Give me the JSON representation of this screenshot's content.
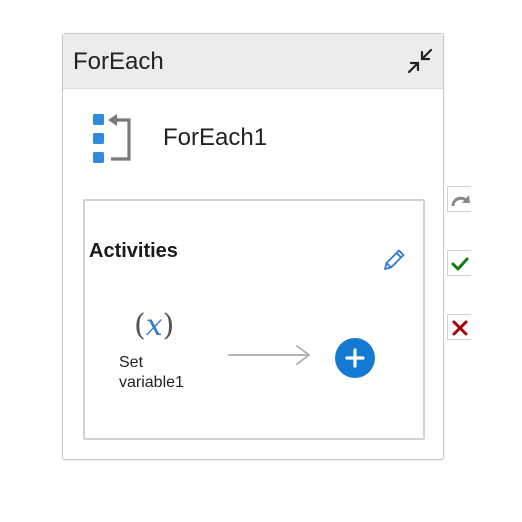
{
  "card": {
    "header_title": "ForEach",
    "activity_name": "ForEach1",
    "collapse_icon": "collapse-arrows-icon",
    "activity_icon": "foreach-loop-icon"
  },
  "activities_panel": {
    "title": "Activities",
    "edit_icon": "pencil-icon",
    "inner_activity": {
      "icon_symbol": "x",
      "label_line1": "Set",
      "label_line2": "variable1"
    },
    "add_icon": "plus-icon"
  },
  "side_actions": [
    {
      "name": "redo",
      "icon": "redo-arrow-icon",
      "color": "#8a8a8a"
    },
    {
      "name": "success",
      "icon": "checkmark-icon",
      "color": "#107c10"
    },
    {
      "name": "failure",
      "icon": "close-x-icon",
      "color": "#a80000"
    }
  ],
  "colors": {
    "header_bg": "#ececec",
    "accent_blue": "#1479d3",
    "icon_blue": "#2f7bd4",
    "border": "#d2d2d2"
  }
}
